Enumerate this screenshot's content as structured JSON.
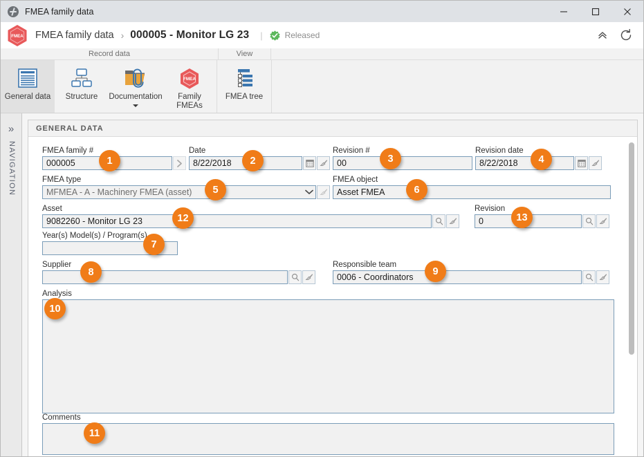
{
  "window": {
    "title": "FMEA family data",
    "icon": "globe-icon",
    "minimize_label": "–",
    "maximize_label": "☐",
    "close_label": "✕"
  },
  "header": {
    "logo_text": "FMEA",
    "app_name": "FMEA family data",
    "separator": "›",
    "record_title": "000005 - Monitor LG 23",
    "divider": "|",
    "status": "Released",
    "collapse_icon": "double-chevron-up-icon",
    "refresh_icon": "refresh-icon"
  },
  "ribbon": {
    "groups": [
      {
        "label": "Record data"
      },
      {
        "label": "View"
      },
      {
        "label": ""
      }
    ],
    "buttons": [
      {
        "label": "General data",
        "icon": "document-lines-icon",
        "selected": true
      },
      {
        "label": "Structure",
        "icon": "hierarchy-icon",
        "selected": false
      },
      {
        "label": "Documentation",
        "icon": "folder-paperclip-icon",
        "selected": false,
        "has_menu": true
      },
      {
        "label": "Family FMEAs",
        "icon": "fmea-hexagon-icon",
        "selected": false
      },
      {
        "label": "FMEA tree",
        "icon": "tree-list-icon",
        "selected": false
      }
    ]
  },
  "navigation": {
    "expand_icon": "double-chevron-right-icon",
    "label": "NAVIGATION"
  },
  "panel": {
    "title": "GENERAL DATA"
  },
  "fields": {
    "fmea_family_number": {
      "label": "FMEA family #",
      "value": "000005",
      "button_icon": "chevron-right-icon"
    },
    "date": {
      "label": "Date",
      "value": "8/22/2018",
      "icons": [
        "calendar-icon",
        "clear-brush-icon"
      ]
    },
    "revision_number": {
      "label": "Revision #",
      "value": "00"
    },
    "revision_date": {
      "label": "Revision date",
      "value": "8/22/2018",
      "icons": [
        "calendar-icon",
        "clear-brush-icon"
      ]
    },
    "fmea_type": {
      "label": "FMEA type",
      "value": "MFMEA - A - Machinery FMEA (asset)",
      "icons": [
        "chevron-down-icon",
        "clear-brush-icon"
      ]
    },
    "fmea_object": {
      "label": "FMEA object",
      "value": "Asset FMEA"
    },
    "asset": {
      "label": "Asset",
      "value": "9082260 - Monitor LG 23",
      "icons": [
        "search-icon",
        "clear-brush-icon"
      ]
    },
    "revision": {
      "label": "Revision",
      "value": "0",
      "icons": [
        "search-icon",
        "clear-brush-icon"
      ]
    },
    "years_models_programs": {
      "label": "Year(s) Model(s) / Program(s)",
      "value": ""
    },
    "supplier": {
      "label": "Supplier",
      "value": "",
      "icons": [
        "search-icon",
        "clear-brush-icon"
      ]
    },
    "responsible_team": {
      "label": "Responsible team",
      "value": "0006 - Coordinators",
      "icons": [
        "search-icon",
        "clear-brush-icon"
      ]
    },
    "analysis": {
      "label": "Analysis",
      "value": ""
    },
    "comments": {
      "label": "Comments",
      "value": ""
    }
  },
  "callouts": [
    {
      "n": "1"
    },
    {
      "n": "2"
    },
    {
      "n": "3"
    },
    {
      "n": "4"
    },
    {
      "n": "5"
    },
    {
      "n": "6"
    },
    {
      "n": "7"
    },
    {
      "n": "8"
    },
    {
      "n": "9"
    },
    {
      "n": "10"
    },
    {
      "n": "11"
    },
    {
      "n": "12"
    },
    {
      "n": "13"
    }
  ],
  "colors": {
    "callout": "#f07c18",
    "accent_blue": "#3b76af",
    "status_green": "#5cb85c",
    "logo_red": "#e8595a"
  }
}
